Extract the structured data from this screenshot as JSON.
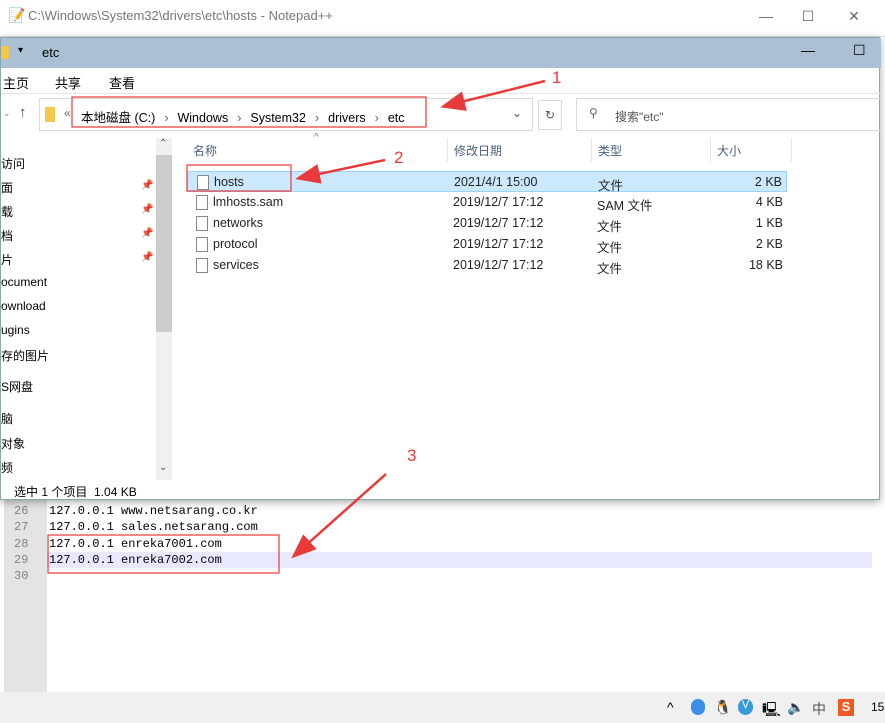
{
  "notepad": {
    "title": "C:\\Windows\\System32\\drivers\\etc\\hosts - Notepad++",
    "lines": [
      {
        "n": "26",
        "text": "127.0.0.1 www.netsarang.co.kr"
      },
      {
        "n": "27",
        "text": "127.0.0.1 sales.netsarang.com"
      },
      {
        "n": "28",
        "text": "127.0.0.1 enreka7001.com"
      },
      {
        "n": "29",
        "text": "127.0.0.1 enreka7002.com"
      },
      {
        "n": "30",
        "text": ""
      }
    ]
  },
  "explorer": {
    "title": "etc",
    "ribbon": [
      "主页",
      "共享",
      "查看"
    ],
    "address": [
      "本地磁盘 (C:)",
      "Windows",
      "System32",
      "drivers",
      "etc"
    ],
    "search_placeholder": "搜索\"etc\"",
    "nav": [
      {
        "label": "访问",
        "pinned": false
      },
      {
        "label": "面",
        "pinned": true
      },
      {
        "label": "载",
        "pinned": true
      },
      {
        "label": "档",
        "pinned": true
      },
      {
        "label": "片",
        "pinned": true
      },
      {
        "label": "ocument"
      },
      {
        "label": "ownload"
      },
      {
        "label": "ugins"
      },
      {
        "label": "存的图片"
      },
      {
        "label": "S网盘"
      },
      {
        "label": "脑"
      },
      {
        "label": "对象"
      },
      {
        "label": "频"
      }
    ],
    "columns": [
      "名称",
      "修改日期",
      "类型",
      "大小"
    ],
    "files": [
      {
        "name": "hosts",
        "date": "2021/4/1 15:00",
        "type": "文件",
        "size": "2 KB",
        "selected": true
      },
      {
        "name": "lmhosts.sam",
        "date": "2019/12/7 17:12",
        "type": "SAM 文件",
        "size": "4 KB"
      },
      {
        "name": "networks",
        "date": "2019/12/7 17:12",
        "type": "文件",
        "size": "1 KB"
      },
      {
        "name": "protocol",
        "date": "2019/12/7 17:12",
        "type": "文件",
        "size": "2 KB"
      },
      {
        "name": "services",
        "date": "2019/12/7 17:12",
        "type": "文件",
        "size": "18 KB"
      }
    ],
    "status": "选中 1 个项目  1.04 KB"
  },
  "taskbar": {
    "ime": "中",
    "clock": "15"
  },
  "annotations": {
    "color": "#e83a3a",
    "labels": [
      "1",
      "2",
      "3"
    ]
  }
}
